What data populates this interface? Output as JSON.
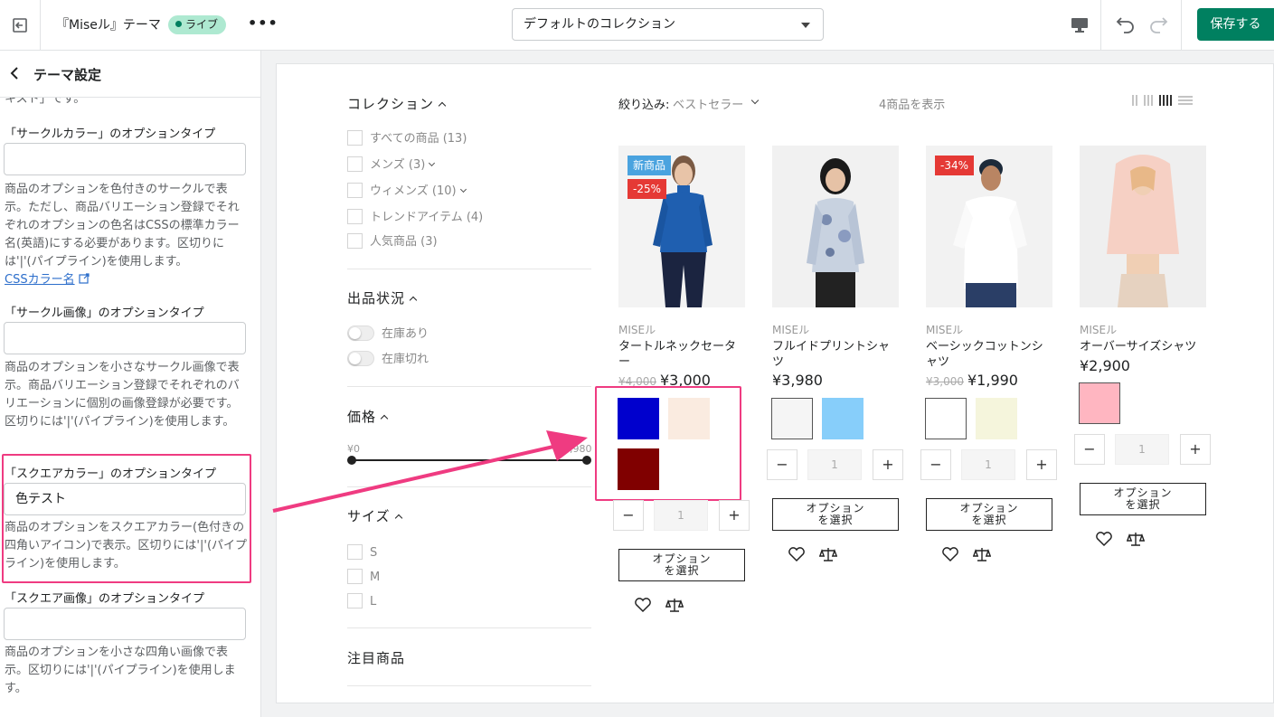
{
  "topbar": {
    "theme_name": "『Miseル』テーマ",
    "live_label": "ライブ",
    "more_label": "•••",
    "collection_value": "デフォルトのコレクション",
    "save_label": "保存する"
  },
  "sidebar": {
    "title": "テーマ設定",
    "top_cut_text": "キスト」です。",
    "sections": [
      {
        "label": "「サークルカラー」のオプションタイプ",
        "value": "",
        "help": "商品のオプションを色付きのサークルで表示。ただし、商品バリエーション登録でそれぞれのオプションの色名はCSSの標準カラー名(英語)にする必要があります。区切りには'|'(パイプライン)を使用します。",
        "link": "CSSカラー名"
      },
      {
        "label": "「サークル画像」のオプションタイプ",
        "value": "",
        "help": "商品のオプションを小さなサークル画像で表示。商品バリエーション登録でそれぞれのバリエーションに個別の画像登録が必要です。区切りには'|'(パイプライン)を使用します。"
      },
      {
        "label": "「スクエアカラー」のオプションタイプ",
        "value": "色テスト",
        "help": "商品のオプションをスクエアカラー(色付きの四角いアイコン)で表示。区切りには'|'(パイプライン)を使用します。"
      },
      {
        "label": "「スクエア画像」のオプションタイプ",
        "value": "",
        "help": "商品のオプションを小さな四角い画像で表示。区切りには'|'(パイプライン)を使用します。"
      }
    ]
  },
  "filters": {
    "collection": {
      "title": "コレクション",
      "items": [
        "すべての商品 (13)",
        "メンズ (3)",
        "ウィメンズ (10)",
        "トレンドアイテム (4)",
        "人気商品 (3)"
      ]
    },
    "availability": {
      "title": "出品状況",
      "items": [
        "在庫あり",
        "在庫切れ"
      ]
    },
    "price": {
      "title": "価格",
      "min": "¥0",
      "max": "¥3,980"
    },
    "size": {
      "title": "サイズ",
      "items": [
        "S",
        "M",
        "L"
      ]
    },
    "featured": {
      "title": "注目商品"
    }
  },
  "toolbar": {
    "sort_label": "絞り込み:",
    "sort_value": "ベストセラー",
    "count_text": "4商品を表示"
  },
  "products": [
    {
      "vendor": "MISEル",
      "name": "タートルネックセーター",
      "old_price": "¥4,000",
      "price": "¥3,000",
      "badges": [
        "新商品",
        "-25%"
      ],
      "swatches": [
        "#0000cd",
        "#faebe0",
        "#800000"
      ],
      "qty": "1",
      "option_label": "オプション\nを選択"
    },
    {
      "vendor": "MISEル",
      "name": "フルイドプリントシャツ",
      "old_price": "",
      "price": "¥3,980",
      "badges": [],
      "swatches": [
        "#f5f5f5",
        "#87cefa"
      ],
      "qty": "1",
      "option_label": "オプション\nを選択"
    },
    {
      "vendor": "MISEル",
      "name": "ベーシックコットンシャツ",
      "old_price": "¥3,000",
      "price": "¥1,990",
      "badges": [
        "-34%"
      ],
      "swatches": [
        "#ffffff",
        "#f5f5dc"
      ],
      "qty": "1",
      "option_label": "オプション\nを選択"
    },
    {
      "vendor": "MISEル",
      "name": "オーバーサイズシャツ",
      "old_price": "",
      "price": "¥2,900",
      "badges": [],
      "swatches": [
        "#ffb6c1"
      ],
      "qty": "1",
      "option_label": "オプション\nを選択"
    }
  ],
  "colors": {
    "accent": "#008060",
    "highlight": "#ef3b81",
    "live_badge": "#aee9d1",
    "sale_badge": "#e53935",
    "new_badge": "#4aa3df"
  }
}
